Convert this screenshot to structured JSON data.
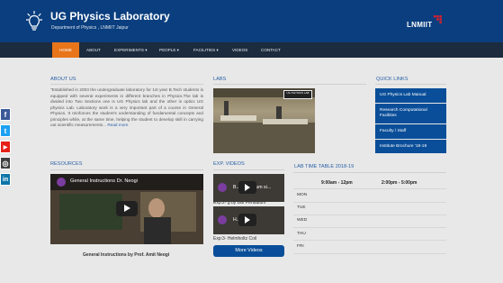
{
  "header": {
    "title": "UG Physics Laboratory",
    "subtitle": "Department of Physics , LNMIIT Jaipur",
    "logo_text": "LNMIIT",
    "bulb_icon": "lightbulb-icon",
    "bg_color": "#0a3e7e"
  },
  "nav": {
    "bg_color": "#1c2b3d",
    "accent_color": "#e8751a",
    "items": [
      {
        "label": "HOME",
        "active": true
      },
      {
        "label": "ABOUT",
        "active": false
      },
      {
        "label": "EXPERIMENTS ▾",
        "active": false
      },
      {
        "label": "PEOPLE ▾",
        "active": false
      },
      {
        "label": "FACILITIES ▾",
        "active": false
      },
      {
        "label": "VIDEOS",
        "active": false
      },
      {
        "label": "CONTACT",
        "active": false
      }
    ]
  },
  "about": {
    "heading": "ABOUT US",
    "text": "\"Established in 2003 the undergraduate laboratory for 1st year B.Tech students is equipped with several experiments in different branches in Physics.The lab is divided into Two Sections one is UG Physics lab and the other is optics UG physics Lab. Laboratory work is a very important part of a course in General Physics. It reinforces the student's understanding of fundamental concepts and principles while, at the same time, helping the student to develop skill in carrying out scientific measurements...",
    "read_more": "Read more"
  },
  "labs": {
    "heading": "LABS",
    "image_label": "UG PHYSICS LAB"
  },
  "quick_links": {
    "heading": "QUICK LINKS",
    "items": [
      "UG Physics Lab Manual",
      "Research Computational Facilities",
      "Faculty / Staff",
      "Institute Brochure '18-19"
    ]
  },
  "social": [
    {
      "icon": "facebook-icon",
      "glyph": "f",
      "color": "#3b5998"
    },
    {
      "icon": "twitter-icon",
      "glyph": "t",
      "color": "#1da1f2"
    },
    {
      "icon": "youtube-icon",
      "glyph": "▶",
      "color": "#e62117"
    },
    {
      "icon": "instagram-icon",
      "glyph": "◎",
      "color": "#3f3f3f"
    },
    {
      "icon": "linkedin-icon",
      "glyph": "in",
      "color": "#0e76a8"
    }
  ],
  "resources": {
    "heading": "RESOURCES",
    "video_title": "General Instructions Dr. Neogi",
    "caption": "General Instructions by Prof. Amit Neogi"
  },
  "exp_videos": {
    "heading": "EXP. VIDEOS",
    "items": [
      {
        "title": "B... Pendulum si...",
        "caption": "Exp:2- g by Bar Pendulum"
      },
      {
        "title": "H... Coil -",
        "caption": "Exp:3- Helmholtz Coil"
      }
    ],
    "more_label": "More Videos"
  },
  "timetable": {
    "heading": "LAB TIME TABLE 2018-19",
    "columns": [
      "9:00am - 12pm",
      "2:00pm - 5:00pm"
    ],
    "days": [
      "MON",
      "TUE",
      "WED",
      "THU",
      "FRI"
    ]
  }
}
